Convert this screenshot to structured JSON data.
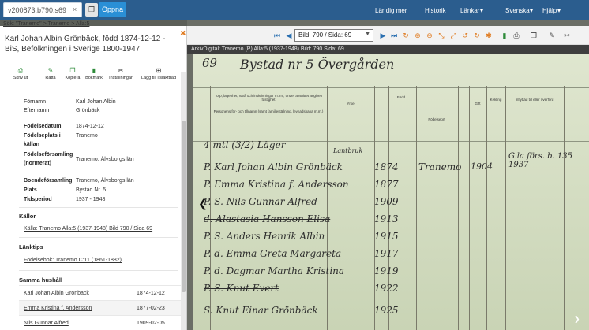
{
  "topbar": {
    "search_value": "v200873.b790.s69",
    "clear_glyph": "×",
    "open_label": "Öppna",
    "nav": [
      "Lär dig mer",
      "Historik",
      "Länkar",
      "Svenska",
      "Hjälp"
    ],
    "dropdown_glyph": "▾"
  },
  "panel": {
    "breadcrumb": "Sök: \"Tranemo\" > Tranemo > Alla:5",
    "close_glyph": "✖",
    "title": "Karl Johan Albin Grönbäck, född 1874-12-12 - BiS, Befolkningen i Sverige 1800-1947",
    "actions": [
      {
        "icon": "print-icon",
        "glyph": "⎙",
        "label": "Skriv ut"
      },
      {
        "icon": "pencil-icon",
        "glyph": "✎",
        "label": "Rätta"
      },
      {
        "icon": "copy-icon",
        "glyph": "❐",
        "label": "Kopiera"
      },
      {
        "icon": "bookmark-icon",
        "glyph": "▮",
        "label": "Bokmärk"
      },
      {
        "icon": "wrench-icon",
        "glyph": "✂",
        "label": "Inställningar"
      },
      {
        "icon": "add-to-family-tree-icon",
        "glyph": "⊞",
        "label": "Lägg till i släktträd"
      }
    ],
    "fields": [
      {
        "label": "Förnamn",
        "value": "Karl Johan Albin"
      },
      {
        "label": "Efternamn",
        "value": "Grönbäck"
      },
      {
        "label": "Födelsedatum",
        "value": "1874-12-12"
      },
      {
        "label": "Födelseplats i källan",
        "value": "Tranemo"
      },
      {
        "label": "Födelseförsamling (normerat)",
        "value": "Tranemo, Älvsborgs län"
      },
      {
        "label": "Boendeförsamling",
        "value": "Tranemo, Älvsborgs län"
      },
      {
        "label": "Plats",
        "value": "Bystad Nr. 5"
      },
      {
        "label": "Tidsperiod",
        "value": "1937 - 1948"
      }
    ],
    "sources_heading": "Källor",
    "source_link": "Källa: Tranemo Alla:5 (1937-1948) Bild 790 / Sida 69",
    "links_heading": "Länktips",
    "link_tip": "Födelsebok: Tranemo C:11 (1861-1882)",
    "household_heading": "Samma hushåll",
    "household": [
      {
        "name": "Karl Johan Albin Grönbäck",
        "date": "1874-12-12"
      },
      {
        "name": "Emma Kristina f. Andersson",
        "date": "1877-02-23"
      },
      {
        "name": "Nils Gunnar Alfred",
        "date": "1909-02-05"
      }
    ]
  },
  "viewer": {
    "page_select": "Bild: 790 / Sida: 69",
    "caption": "ArkivDigital: Tranemo (P) Alla:5 (1937-1948) Bild: 790 Sida: 69",
    "prev_glyph": "❮",
    "collapse_glyph": "❯"
  },
  "scan": {
    "page_no": "69",
    "heading": "Bystad nr 5 Övergården",
    "col_torp": "Torp, lägenhet, varå och inskrivningar m. m., under avsnittet angiven fastighet",
    "col_personer": "Personens för- och tillnamn (samt familjeställning, levnadsbana m.m.)",
    "col_yrke": "Yrke",
    "col_fodd": "Född",
    "col_fodelseort": "Födelseort",
    "col_gift": "Gift",
    "col_kekling": "Kekling",
    "col_inflyttad": "Inflyttad till eller överförd",
    "hw_rows": [
      "4 mtl (3/2) Läger",
      "P. Karl Johan Albin Grönbäck",
      "P. Emma Kristina f. Andersson",
      "P. S. Nils Gunnar Alfred",
      "d. Alastasia Hansson Elisa",
      "P. S. Anders Henrik Albin",
      "P. d. Emma Greta Margareta",
      "P. d. Dagmar Martha Kristina",
      "P. S. Knut Evert",
      "S. Knut Einar Grönbäck"
    ],
    "hw_years": [
      "1874",
      "1877",
      "1909",
      "1913",
      "1915",
      "1917",
      "1919",
      "1922",
      "1925"
    ],
    "hw_place": "Tranemo",
    "hw_gift": "1904",
    "hw_inflyttad": "G.la förs. b. 135 1937",
    "hw_yrke": "Lantbruk"
  }
}
